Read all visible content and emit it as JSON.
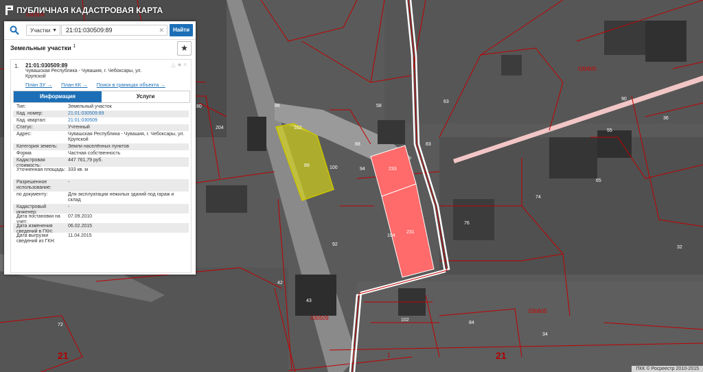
{
  "app": {
    "title": "ПУБЛИЧНАЯ КАДАСТРОВАЯ КАРТА"
  },
  "search": {
    "type_selected": "Участки",
    "query": "21:01:030509:89",
    "submit_label": "Найти"
  },
  "panel": {
    "section_title": "Земельные участки",
    "count": "1",
    "result": {
      "index": "1.",
      "number": "21:01:030509:89",
      "address": "Чувашская Республика - Чувашия, г. Чебоксары, ул. Крупской",
      "links": [
        "План ЗУ →",
        "План КК →",
        "Поиск в границах объекта →"
      ],
      "tabs": {
        "info": "Информация",
        "services": "Услуги"
      },
      "rows": [
        {
          "key": "Тип:",
          "value": "Земельный участок"
        },
        {
          "key": "Кад. номер:",
          "value": "21:01:030509:89",
          "link": true
        },
        {
          "key": "Кад. квартал:",
          "value": "21:01:030509",
          "link": true
        },
        {
          "key": "Статус:",
          "value": "Учтенный"
        },
        {
          "key": "Адрес:",
          "value": "Чувашская Республика - Чувашия, г. Чебоксары, ул. Крупской"
        },
        {
          "key": "Категория земель:",
          "value": "Земли населённых пунктов"
        },
        {
          "key": "Форма собственности:",
          "value": "Частная собственность"
        },
        {
          "key": "Кадастровая стоимость:",
          "value": "447 761,79 руб."
        },
        {
          "key": "Уточненная площадь:",
          "value": "333 кв. м"
        },
        {
          "key": "Разрешенное использование:",
          "value": "-"
        },
        {
          "key": "по документу:",
          "value": "Для эксплуатации нежилых зданий под гараж и склад"
        },
        {
          "key": "Кадастровый инженер:",
          "value": "-"
        },
        {
          "key": "Дата постановки на учет:",
          "value": "07.09.2010"
        },
        {
          "key": "Дата изменения сведений в ГКН:",
          "value": "06.02.2015"
        },
        {
          "key": "Дата выгрузки сведений из ГКН:",
          "value": "11.04.2015"
        }
      ]
    }
  },
  "map": {
    "labels": {
      "q_top": "030509",
      "q_right": "030605",
      "q_bottom": "030509",
      "q_bottom_right": "030605",
      "big_left": "21",
      "big_right": "21",
      "bottom_mid": "1",
      "p80": "80",
      "p204": "204",
      "p86": "86",
      "p89": "89",
      "p102a": "102",
      "p100": "100",
      "p88": "88",
      "p94": "94",
      "p233": "233",
      "p231": "231",
      "p104": "104",
      "p92": "92",
      "p90": "90",
      "p83": "83",
      "p63": "63",
      "p58": "58",
      "p55": "55",
      "p36": "36",
      "p65": "65",
      "p74": "74",
      "p76": "76",
      "p34": "34",
      "p72": "72",
      "p43": "43",
      "p102b": "102",
      "p84": "84",
      "p32": "32",
      "p42": "42"
    },
    "copyright": "ПКК © Росреестр 2010-2015"
  },
  "colors": {
    "highlight": "#e6e20f",
    "selected": "#ff6a6a",
    "border": "#d40000",
    "accent": "#1c6fb6"
  }
}
